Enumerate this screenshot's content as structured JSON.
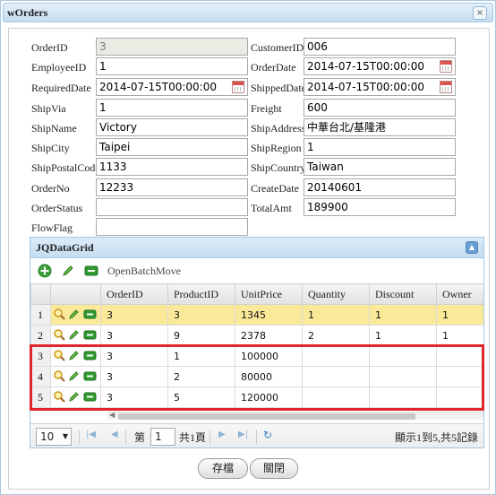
{
  "dialog": {
    "title": "wOrders",
    "close_glyph": "×"
  },
  "form": {
    "order_id": {
      "label": "OrderID",
      "value": "3"
    },
    "customer_id": {
      "label": "CustomerID",
      "value": "006"
    },
    "employee_id": {
      "label": "EmployeeID",
      "value": "1"
    },
    "order_date": {
      "label": "OrderDate",
      "value": "2014-07-15T00:00:00"
    },
    "required_date": {
      "label": "RequiredDate",
      "value": "2014-07-15T00:00:00"
    },
    "shipped_date": {
      "label": "ShippedDate",
      "value": "2014-07-15T00:00:00"
    },
    "ship_via": {
      "label": "ShipVia",
      "value": "1"
    },
    "freight": {
      "label": "Freight",
      "value": "600"
    },
    "ship_name": {
      "label": "ShipName",
      "value": "Victory"
    },
    "ship_address": {
      "label": "ShipAddress",
      "value": "中華台北/基隆港"
    },
    "ship_city": {
      "label": "ShipCity",
      "value": "Taipei"
    },
    "ship_region": {
      "label": "ShipRegion",
      "value": "1"
    },
    "ship_postal_code": {
      "label": "ShipPostalCode",
      "value": "1133"
    },
    "ship_country": {
      "label": "ShipCountry",
      "value": "Taiwan"
    },
    "order_no": {
      "label": "OrderNo",
      "value": "12233"
    },
    "create_date": {
      "label": "CreateDate",
      "value": "20140601"
    },
    "order_status": {
      "label": "OrderStatus",
      "value": ""
    },
    "total_amt": {
      "label": "TotalAmt",
      "value": "189900"
    },
    "flow_flag": {
      "label": "FlowFlag",
      "value": ""
    }
  },
  "grid": {
    "title": "JQDataGrid",
    "toolbar": {
      "batch_label": "OpenBatchMove",
      "icons": [
        "add-icon",
        "edit-icon",
        "delete-icon"
      ]
    },
    "columns": [
      "OrderID",
      "ProductID",
      "UnitPrice",
      "Quantity",
      "Discount",
      "Owner"
    ],
    "rows": [
      {
        "rn": "1",
        "cells": [
          "3",
          "3",
          "1345",
          "1",
          "1",
          "1"
        ]
      },
      {
        "rn": "2",
        "cells": [
          "3",
          "9",
          "2378",
          "2",
          "1",
          "1"
        ]
      },
      {
        "rn": "3",
        "cells": [
          "3",
          "1",
          "100000",
          "",
          "",
          ""
        ]
      },
      {
        "rn": "4",
        "cells": [
          "3",
          "2",
          "80000",
          "",
          "",
          ""
        ]
      },
      {
        "rn": "5",
        "cells": [
          "3",
          "5",
          "120000",
          "",
          "",
          ""
        ]
      }
    ],
    "selected_row": 1,
    "pager": {
      "page_size": "10",
      "page_prefix": "第",
      "page_value": "1",
      "page_suffix": "共1頁",
      "info": "顯示1到5,共5記錄"
    }
  },
  "buttons": {
    "save": "存檔",
    "close": "關閉"
  },
  "colors": {
    "highlight_border": "#e0252e",
    "selected_row": "#fbe99a",
    "title_bar": "#c5dbf0"
  }
}
